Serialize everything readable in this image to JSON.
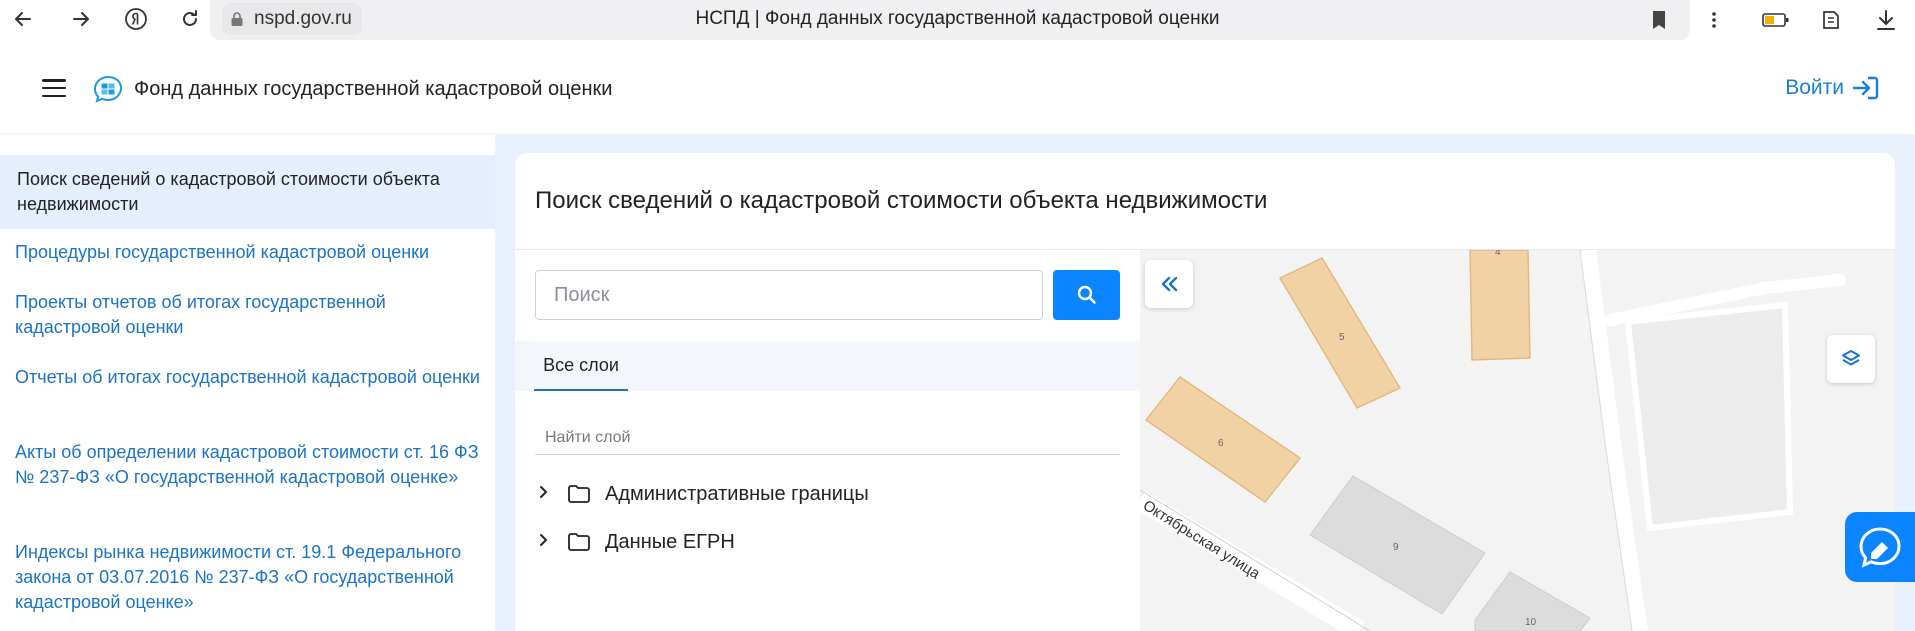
{
  "browser": {
    "url": "nspd.gov.ru",
    "tab_title": "НСПД | Фонд данных государственной кадастровой оценки"
  },
  "header": {
    "title": "Фонд данных государственной кадастровой оценки",
    "login_label": "Войти"
  },
  "sidebar": {
    "items": [
      {
        "label": "Поиск сведений о кадастровой стоимости объекта недвижимости"
      },
      {
        "label": "Процедуры государственной кадастровой оценки"
      },
      {
        "label": "Проекты отчетов об итогах государственной кадастровой оценки"
      },
      {
        "label": "Отчеты об итогах государственной кадастровой оценки"
      },
      {
        "label": "Акты об определении кадастровой стоимости ст. 16 ФЗ № 237-ФЗ «О государственной кадастровой оценке»"
      },
      {
        "label": "Индексы рынка недвижимости ст. 19.1 Федерального закона от 03.07.2016 № 237-ФЗ «О государственной кадастровой оценке»"
      }
    ]
  },
  "main": {
    "title": "Поиск сведений о кадастровой стоимости объекта недвижимости",
    "search_placeholder": "Поиск",
    "tab_all_layers": "Все слои",
    "layer_filter_placeholder": "Найти слой",
    "layers": [
      {
        "label": "Административные границы"
      },
      {
        "label": "Данные ЕГРН"
      }
    ]
  },
  "map": {
    "street_label": "Октябрьская улица",
    "buildings": [
      "4",
      "5",
      "6",
      "9",
      "10"
    ]
  },
  "colors": {
    "accent": "#0a84ff",
    "link": "#1a73c8",
    "parcel_fill": "#f1d2a4",
    "building_fill": "#dcdcdc"
  }
}
